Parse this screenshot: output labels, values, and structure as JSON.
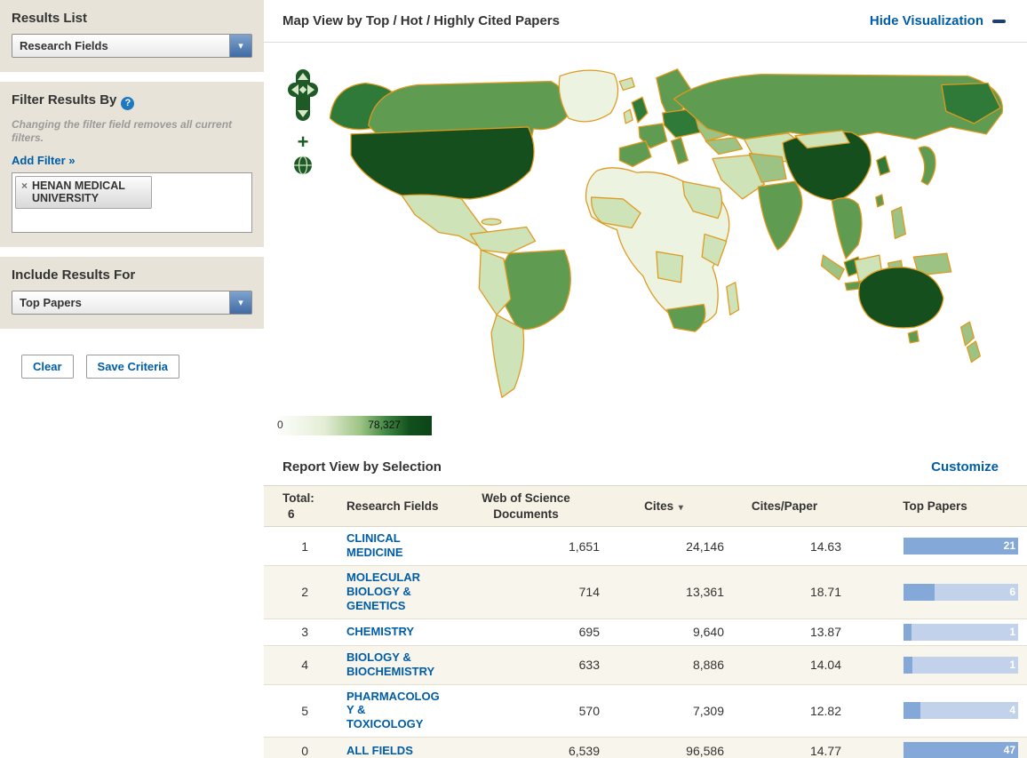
{
  "sidebar": {
    "results_list": {
      "title": "Results List",
      "selected": "Research Fields"
    },
    "filter": {
      "title": "Filter Results By",
      "help_icon": "?",
      "note": "Changing the filter field removes all current filters.",
      "add_filter": "Add Filter »",
      "remove_icon": "×",
      "active_filter": "HENAN MEDICAL UNIVERSITY"
    },
    "include": {
      "title": "Include Results For",
      "selected": "Top Papers"
    },
    "actions": {
      "clear": "Clear",
      "save": "Save Criteria"
    }
  },
  "icons": {
    "chevron_down": "▾",
    "sort_desc": "▾",
    "zoom_in": "+"
  },
  "map_view": {
    "title": "Map View by Top / Hot / Highly Cited Papers",
    "hide_label": "Hide Visualization",
    "legend": {
      "min": "0",
      "max": "78,327"
    }
  },
  "report": {
    "title": "Report View by Selection",
    "customize": "Customize",
    "header": {
      "total_label": "Total:",
      "total_value": "6",
      "research_fields": "Research Fields",
      "docs": "Web of Science Documents",
      "cites": "Cites",
      "cites_per_paper": "Cites/Paper",
      "top_papers": "Top Papers"
    },
    "rows": [
      {
        "rank": "1",
        "field": "CLINICAL MEDICINE",
        "docs": "1,651",
        "cites": "24,146",
        "cpp": "14.63",
        "top_label": "21",
        "bar_pct": 100
      },
      {
        "rank": "2",
        "field": "MOLECULAR BIOLOGY & GENETICS",
        "docs": "714",
        "cites": "13,361",
        "cpp": "18.71",
        "top_label": "6",
        "bar_pct": 27
      },
      {
        "rank": "3",
        "field": "CHEMISTRY",
        "docs": "695",
        "cites": "9,640",
        "cpp": "13.87",
        "top_label": "1",
        "bar_pct": 7
      },
      {
        "rank": "4",
        "field": "BIOLOGY & BIOCHEMISTRY",
        "docs": "633",
        "cites": "8,886",
        "cpp": "14.04",
        "top_label": "1",
        "bar_pct": 8
      },
      {
        "rank": "5",
        "field": "PHARMACOLOGY & TOXICOLOGY",
        "docs": "570",
        "cites": "7,309",
        "cpp": "12.82",
        "top_label": "4",
        "bar_pct": 15
      },
      {
        "rank": "0",
        "field": "ALL FIELDS",
        "docs": "6,539",
        "cites": "96,586",
        "cpp": "14.77",
        "top_label": "47",
        "bar_pct": 100
      }
    ]
  },
  "colors": {
    "link_blue": "#005da6",
    "map_border_orange": "#df9a1f",
    "bar_fill": "#84a8d8",
    "bar_track": "#c2d2ea",
    "green_scale": [
      "#ecf3e0",
      "#cfe3b8",
      "#9cc383",
      "#5f9b50",
      "#2f7a38",
      "#154f1e"
    ]
  }
}
